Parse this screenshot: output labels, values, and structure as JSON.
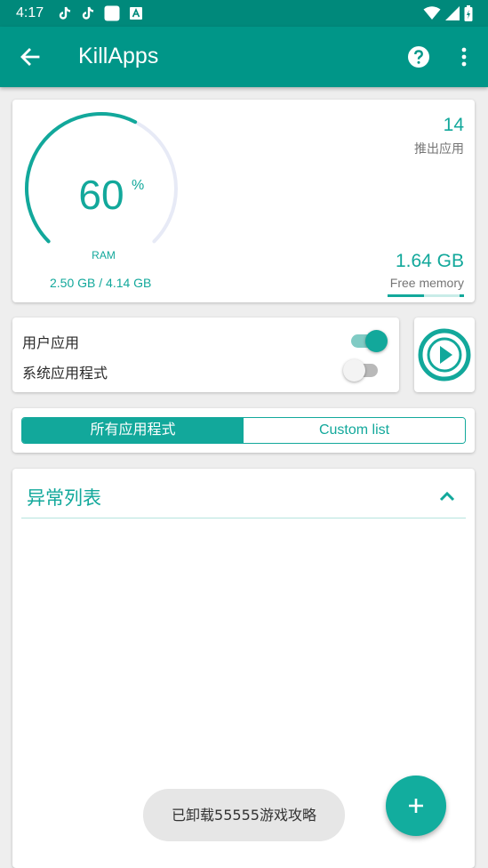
{
  "status_bar": {
    "time": "4:17",
    "icons": [
      "tiktok-icon",
      "tiktok-icon",
      "notification-square-icon",
      "app-a-icon",
      "wifi-icon",
      "signal-icon",
      "battery-charging-icon"
    ]
  },
  "app_bar": {
    "title": "KillApps",
    "icons": [
      "back-arrow-icon",
      "help-icon",
      "more-vert-icon"
    ]
  },
  "memory": {
    "ram_percent": "60",
    "percent_sign": "%",
    "ram_label": "RAM",
    "ram_fraction": 0.6,
    "used_total": "2.50 GB / 4.14 GB",
    "killed_count": "14",
    "killed_label": "推出应用",
    "free_value": "1.64 GB",
    "free_label": "Free memory",
    "free_fraction": 0.48
  },
  "toggles": {
    "user_apps": {
      "label": "用户应用",
      "on": true
    },
    "system_apps": {
      "label": "系统应用程式",
      "on": false
    }
  },
  "segment": {
    "all_apps": "所有应用程式",
    "custom_list": "Custom list",
    "selected": "all_apps"
  },
  "list": {
    "title": "异常列表"
  },
  "toast": {
    "message": "已卸载55555游戏攻略"
  },
  "colors": {
    "primary": "#009688",
    "primary_dark": "#00897b",
    "accent": "#12a89b",
    "background": "#eeeeee"
  }
}
